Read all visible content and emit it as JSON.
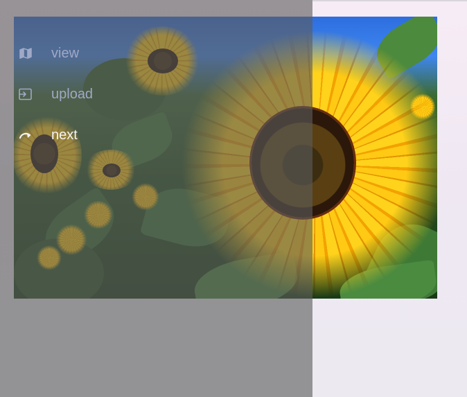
{
  "menu": {
    "items": [
      {
        "label": "view",
        "icon": "map-icon",
        "active": false
      },
      {
        "label": "upload",
        "icon": "sign-in-icon",
        "active": false
      },
      {
        "label": "next",
        "icon": "redo-arrow-icon",
        "active": true
      }
    ]
  },
  "colors": {
    "overlay": "rgba(92,92,92,0.62)",
    "menu_text": "#9fa9c6",
    "menu_text_active": "#f4f4f4",
    "background": "#efe8f2"
  }
}
